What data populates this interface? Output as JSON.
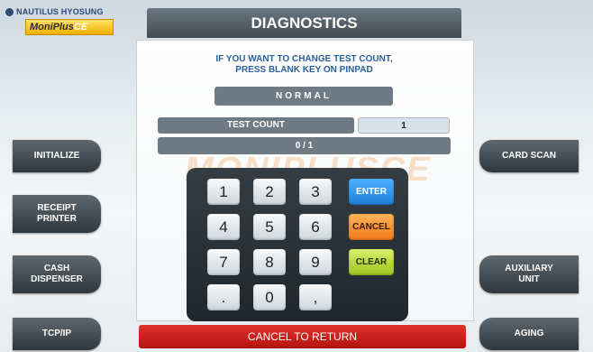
{
  "brand": {
    "company": "NAUTILUS HYOSUNG",
    "product": "MoniPlus",
    "product_suffix": "CE"
  },
  "header": {
    "title": "DIAGNOSTICS"
  },
  "instruction": {
    "line1": "IF YOU WANT TO CHANGE TEST COUNT,",
    "line2": "PRESS BLANK KEY ON PINPAD"
  },
  "mode": {
    "value": "NORMAL"
  },
  "test_count": {
    "label": "TEST COUNT",
    "value": "1"
  },
  "progress": {
    "text": "0 / 1"
  },
  "watermark": {
    "text": "MONIPLUSCE"
  },
  "left_buttons": [
    {
      "label": "INITIALIZE"
    },
    {
      "label": "RECEIPT PRINTER"
    },
    {
      "label": "CASH DISPENSER"
    },
    {
      "label": "TCP/IP"
    }
  ],
  "right_buttons": [
    {
      "label": "CARD SCAN"
    },
    {
      "label": "AUXILIARY UNIT"
    },
    {
      "label": "AGING"
    }
  ],
  "keypad": {
    "digits": [
      "1",
      "2",
      "3",
      "4",
      "5",
      "6",
      "7",
      "8",
      "9",
      ".",
      "0",
      ","
    ],
    "enter": "ENTER",
    "cancel": "CANCEL",
    "clear": "CLEAR"
  },
  "footer": {
    "cancel_label": "CANCEL TO RETURN"
  },
  "colors": {
    "header_bg": "#424c54",
    "enter": "#1e7fd8",
    "cancel": "#ef7a18",
    "clear": "#9fc21d",
    "cancel_to_return": "#c41b16",
    "instruction_text": "#2a5f9e"
  }
}
